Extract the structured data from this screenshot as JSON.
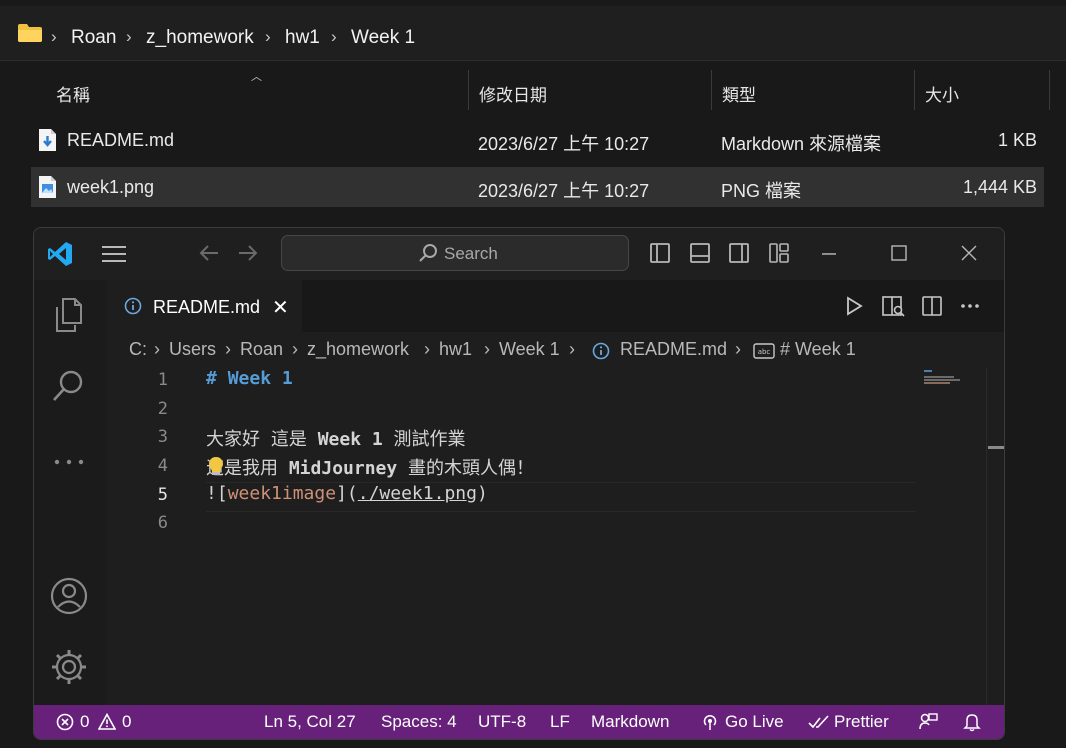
{
  "explorer": {
    "breadcrumb": [
      "Roan",
      "z_homework",
      "hw1",
      "Week 1"
    ],
    "columns": {
      "name": "名稱",
      "modified": "修改日期",
      "type": "類型",
      "size": "大小"
    },
    "files": [
      {
        "name": "README.md",
        "modified": "2023/6/27 上午 10:27",
        "type": "Markdown 來源檔案",
        "size": "1 KB",
        "icon": "markdown-file-icon",
        "selected": false
      },
      {
        "name": "week1.png",
        "modified": "2023/6/27 上午 10:27",
        "type": "PNG 檔案",
        "size": "1,444 KB",
        "icon": "image-file-icon",
        "selected": true
      }
    ]
  },
  "vscode": {
    "search_placeholder": "Search",
    "tab": {
      "label": "README.md",
      "close": "✕"
    },
    "breadcrumbs": [
      "C:",
      "Users",
      "Roan",
      "z_homework",
      "hw1",
      "Week 1",
      "README.md",
      "# Week 1"
    ],
    "lines": [
      {
        "no": "1",
        "text": "# Week 1"
      },
      {
        "no": "2",
        "text": ""
      },
      {
        "no": "3",
        "text": "大家好 這是 Week 1 測試作業"
      },
      {
        "no": "4",
        "text": "這是我用 MidJourney 畫的木頭人偶！"
      },
      {
        "no": "5",
        "text": "![week1image](./week1.png)"
      },
      {
        "no": "6",
        "text": ""
      }
    ],
    "code": {
      "l1_hash": "# ",
      "l1_title": "Week 1",
      "l3_a": "大家好 這是 ",
      "l3_b": "Week 1",
      "l3_c": " 測試作業",
      "l4_a": "這是我用 ",
      "l4_b": "MidJourney",
      "l4_c": " 畫的木頭人偶！",
      "l5_a": "![",
      "l5_alt": "week1image",
      "l5_b": "](",
      "l5_url": "./week1.png",
      "l5_c": ")"
    },
    "active_line": 5,
    "status": {
      "errors": "0",
      "warnings": "0",
      "position": "Ln 5, Col 27",
      "spaces": "Spaces: 4",
      "encoding": "UTF-8",
      "eol": "LF",
      "language": "Markdown",
      "golive": "Go Live",
      "prettier": "Prettier"
    },
    "colors": {
      "statusbar": "#68217a",
      "heading": "#569cd6",
      "link_text": "#ce9178",
      "logo": "#23a9f2"
    }
  }
}
